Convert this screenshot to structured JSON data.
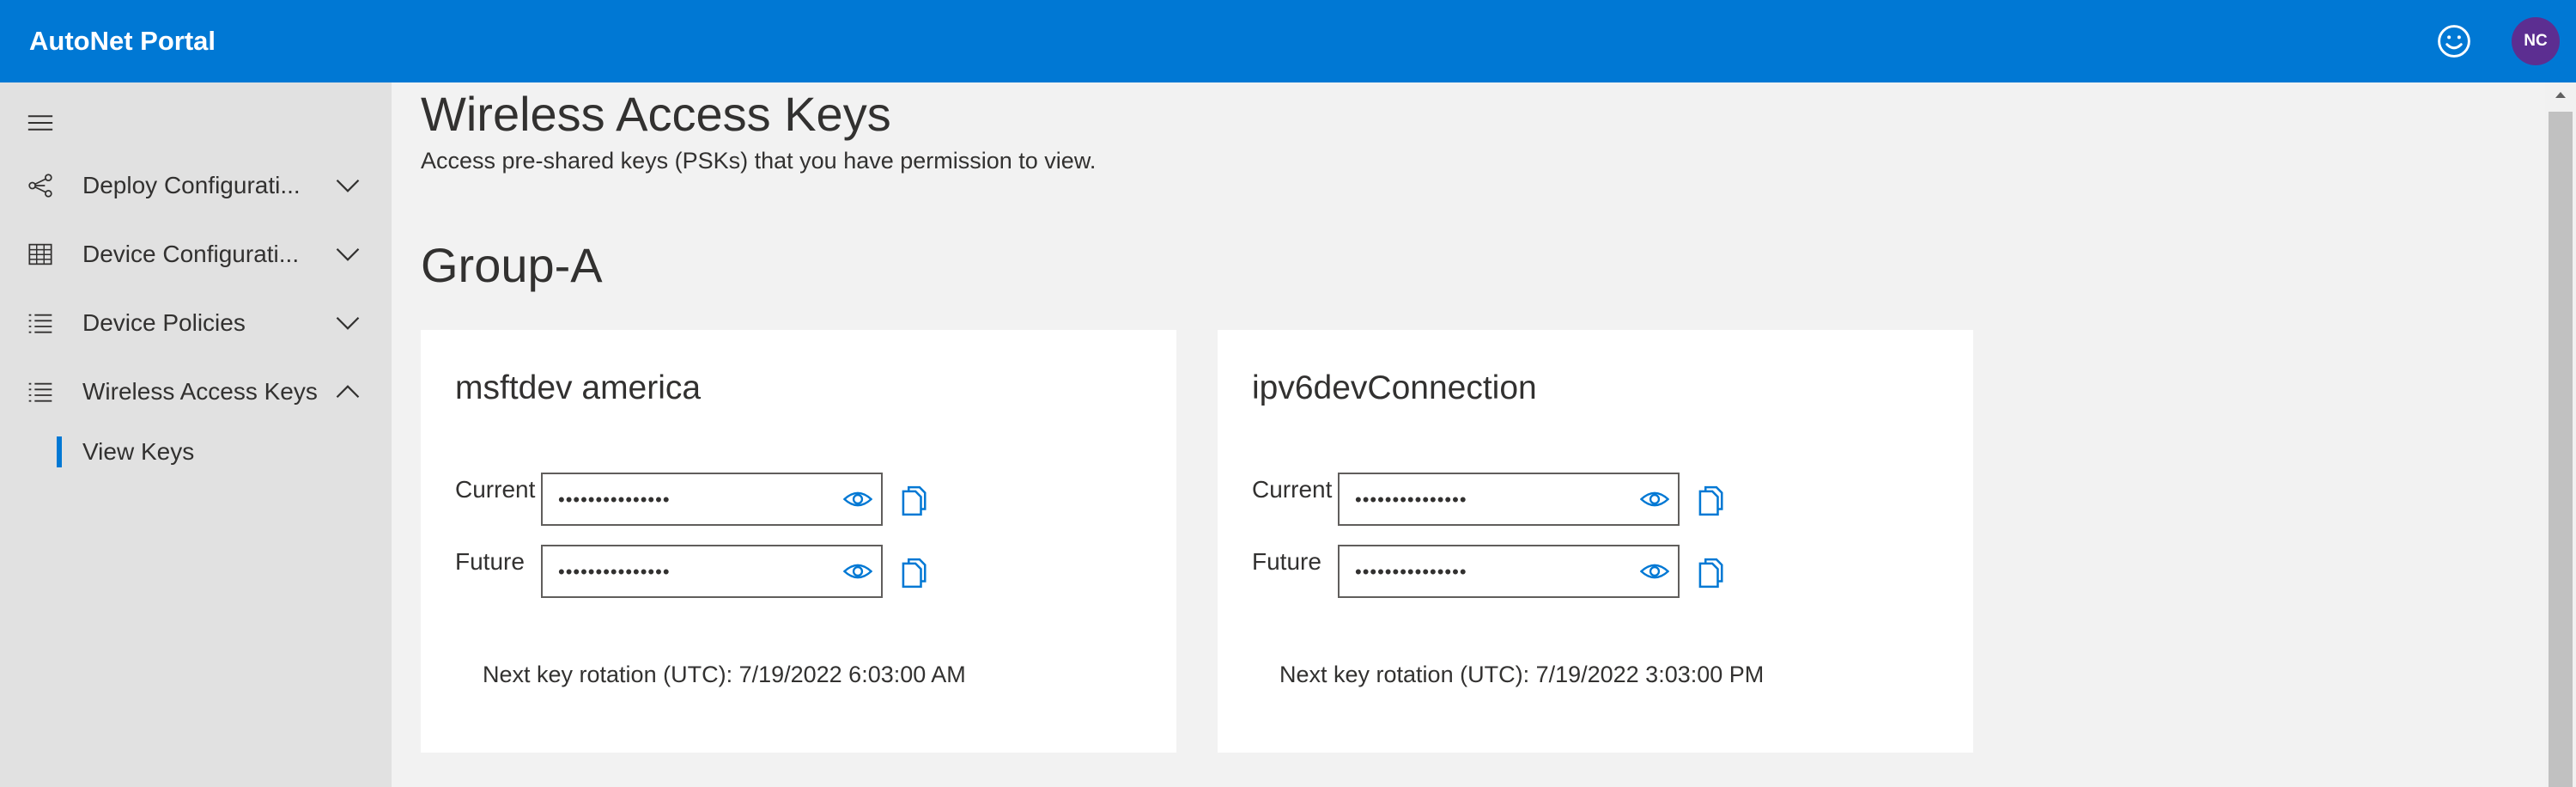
{
  "header": {
    "app_title": "AutoNet Portal",
    "feedback_icon": "smiley-icon",
    "avatar_initials": "NC",
    "colors": {
      "bar": "#0078d4",
      "avatar": "#5c2e91"
    }
  },
  "sidebar": {
    "menu_icon": "hamburger-icon",
    "items": [
      {
        "label": "Deploy Configurati...",
        "icon": "deploy-network-icon",
        "expanded": false
      },
      {
        "label": "Device Configurati...",
        "icon": "grid-table-icon",
        "expanded": false
      },
      {
        "label": "Device Policies",
        "icon": "list-icon",
        "expanded": false
      },
      {
        "label": "Wireless Access Keys",
        "icon": "list-icon",
        "expanded": true
      }
    ],
    "sub_items": [
      {
        "label": "View Keys",
        "selected": true
      }
    ]
  },
  "main": {
    "title": "Wireless Access Keys",
    "subtitle": "Access pre-shared keys (PSKs) that you have permission to view.",
    "group": "Group-A",
    "cards": [
      {
        "name": "msftdev america",
        "current_label": "Current",
        "current_value": "•••••••••••••••",
        "future_label": "Future",
        "future_value": "•••••••••••••••",
        "rotation": "Next key rotation (UTC): 7/19/2022 6:03:00 AM"
      },
      {
        "name": "ipv6devConnection",
        "current_label": "Current",
        "current_value": "•••••••••••••••",
        "future_label": "Future",
        "future_value": "•••••••••••••••",
        "rotation": "Next key rotation (UTC): 7/19/2022 3:03:00 PM"
      }
    ]
  }
}
